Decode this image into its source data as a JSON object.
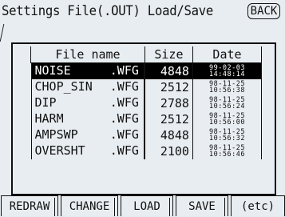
{
  "header": {
    "title": "Settings File(.OUT) Load/Save",
    "back_label": "BACK"
  },
  "table": {
    "columns": [
      "File name",
      "Size",
      "Date"
    ],
    "rows": [
      {
        "name": "NOISE",
        "ext": ".WFG",
        "size": "4848",
        "date1": "99-02-03",
        "date2": "14:48:14",
        "selected": true
      },
      {
        "name": "CHOP_SIN",
        "ext": ".WFG",
        "size": "2512",
        "date1": "98-11-25",
        "date2": "10:56:38",
        "selected": false
      },
      {
        "name": "DIP",
        "ext": ".WFG",
        "size": "2788",
        "date1": "98-11-25",
        "date2": "10:56:24",
        "selected": false
      },
      {
        "name": "HARM",
        "ext": ".WFG",
        "size": "2512",
        "date1": "98-11-25",
        "date2": "10:56:00",
        "selected": false
      },
      {
        "name": "AMPSWP",
        "ext": ".WFG",
        "size": "4848",
        "date1": "98-11-25",
        "date2": "10:56:32",
        "selected": false
      },
      {
        "name": "OVERSHT",
        "ext": ".WFG",
        "size": "2100",
        "date1": "98-11-25",
        "date2": "10:56:46",
        "selected": false
      }
    ]
  },
  "softkeys": {
    "redraw": "REDRAW",
    "change": "CHANGE",
    "load": "LOAD",
    "save": "SAVE",
    "etc": "(etc)"
  }
}
